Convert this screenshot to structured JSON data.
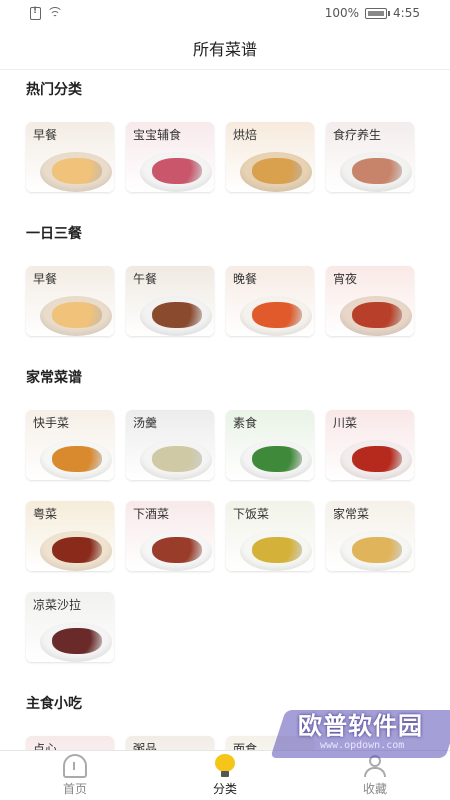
{
  "status_bar": {
    "battery_text": "100%",
    "time": "4:55"
  },
  "header": {
    "title": "所有菜谱"
  },
  "sections": [
    {
      "title": "热门分类",
      "items": [
        {
          "label": "早餐",
          "bg": "#f3ece4",
          "plate": "#e9dccb",
          "food": "#f0c27a"
        },
        {
          "label": "宝宝辅食",
          "bg": "#f7e9ec",
          "plate": "#f4f4f4",
          "food": "#c9566a"
        },
        {
          "label": "烘焙",
          "bg": "#f6eadc",
          "plate": "#e7d2b4",
          "food": "#d9a04e"
        },
        {
          "label": "食疗养生",
          "bg": "#f4ecec",
          "plate": "#f2f2f0",
          "food": "#c8846a"
        }
      ]
    },
    {
      "title": "一日三餐",
      "items": [
        {
          "label": "早餐",
          "bg": "#f3ece4",
          "plate": "#e9dccb",
          "food": "#f0c27a"
        },
        {
          "label": "午餐",
          "bg": "#efe9e1",
          "plate": "#f2f2f2",
          "food": "#8a4a2e"
        },
        {
          "label": "晚餐",
          "bg": "#f7ebe4",
          "plate": "#f5f2ee",
          "food": "#e05a2b"
        },
        {
          "label": "宵夜",
          "bg": "#f9e9e6",
          "plate": "#e8d6c8",
          "food": "#b8402a"
        }
      ]
    },
    {
      "title": "家常菜谱",
      "items": [
        {
          "label": "快手菜",
          "bg": "#f6efe7",
          "plate": "#f6f6f4",
          "food": "#d98a2f"
        },
        {
          "label": "汤羹",
          "bg": "#ececec",
          "plate": "#f4f4f2",
          "food": "#cfc9a6"
        },
        {
          "label": "素食",
          "bg": "#e9f3e6",
          "plate": "#f4f4f4",
          "food": "#3f8a3a"
        },
        {
          "label": "川菜",
          "bg": "#f9e7e7",
          "plate": "#f3ecec",
          "food": "#b52a1c"
        },
        {
          "label": "粤菜",
          "bg": "#f5ecd9",
          "plate": "#efe2cf",
          "food": "#8a2a1a"
        },
        {
          "label": "下酒菜",
          "bg": "#f8e9ea",
          "plate": "#f6f6f6",
          "food": "#9a3c2a"
        },
        {
          "label": "下饭菜",
          "bg": "#f1f3e8",
          "plate": "#f6f6f2",
          "food": "#d4b23a"
        },
        {
          "label": "家常菜",
          "bg": "#f5f1e9",
          "plate": "#f6f6f4",
          "food": "#e0b45a"
        },
        {
          "label": "凉菜沙拉",
          "bg": "#f1f1ee",
          "plate": "#f4f4f4",
          "food": "#6a2a2a"
        }
      ]
    },
    {
      "title": "主食小吃",
      "items": [
        {
          "label": "点心",
          "bg": "#f7e9ea",
          "plate": "#f2dede",
          "food": "#d98a7a"
        },
        {
          "label": "粥品",
          "bg": "#f2ece6",
          "plate": "#f4f4f4",
          "food": "#9a4a3a"
        },
        {
          "label": "面食",
          "bg": "#f3f1e9",
          "plate": "#f4f4f2",
          "food": "#d9c48a"
        }
      ]
    }
  ],
  "bottom_nav": [
    {
      "label": "首页",
      "icon": "home-icon",
      "active": false
    },
    {
      "label": "分类",
      "icon": "bulb-icon",
      "active": true
    },
    {
      "label": "收藏",
      "icon": "user-icon",
      "active": false
    }
  ],
  "watermark": {
    "text": "欧普软件园",
    "url": "www.opdown.com"
  }
}
